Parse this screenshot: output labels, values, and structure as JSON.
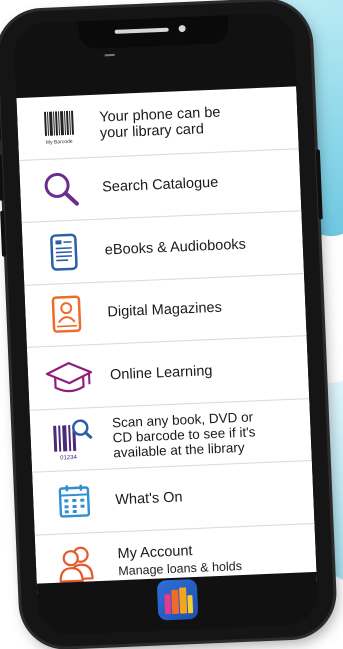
{
  "menu": {
    "items": [
      {
        "id": "library-card",
        "label": "Your phone can be your library card",
        "icon": "barcode-card-icon",
        "icon_caption": "My Barcode",
        "color": "#333333"
      },
      {
        "id": "search-catalogue",
        "label": "Search Catalogue",
        "icon": "magnifier-icon",
        "color": "#6a2c8f"
      },
      {
        "id": "ebooks",
        "label": "eBooks & Audiobooks",
        "icon": "ebook-reader-icon",
        "color": "#2b5fa8"
      },
      {
        "id": "digital-magazines",
        "label": "Digital Magazines",
        "icon": "magazine-tablet-icon",
        "color": "#f06a2a"
      },
      {
        "id": "online-learning",
        "label": "Online Learning",
        "icon": "graduation-cap-icon",
        "color": "#8e1f7d"
      },
      {
        "id": "scan-barcode",
        "label": "Scan any book, DVD or CD barcode to see if it's available at the library",
        "icon": "barcode-scan-icon",
        "icon_caption": "01234",
        "color": "#4b2a7c"
      },
      {
        "id": "whats-on",
        "label": "What's On",
        "icon": "calendar-icon",
        "color": "#2f8fd0"
      },
      {
        "id": "my-account",
        "label": "My Account",
        "sublabel": "Manage loans & holds",
        "icon": "users-icon",
        "color": "#e45a2b"
      }
    ]
  },
  "app": {
    "icon": "library-app-icon"
  },
  "colors": {
    "phone": "#151515",
    "menu_bg": "#ffffff",
    "divider": "#d9d9d9",
    "accent_cyan": "#8fd8ea"
  }
}
